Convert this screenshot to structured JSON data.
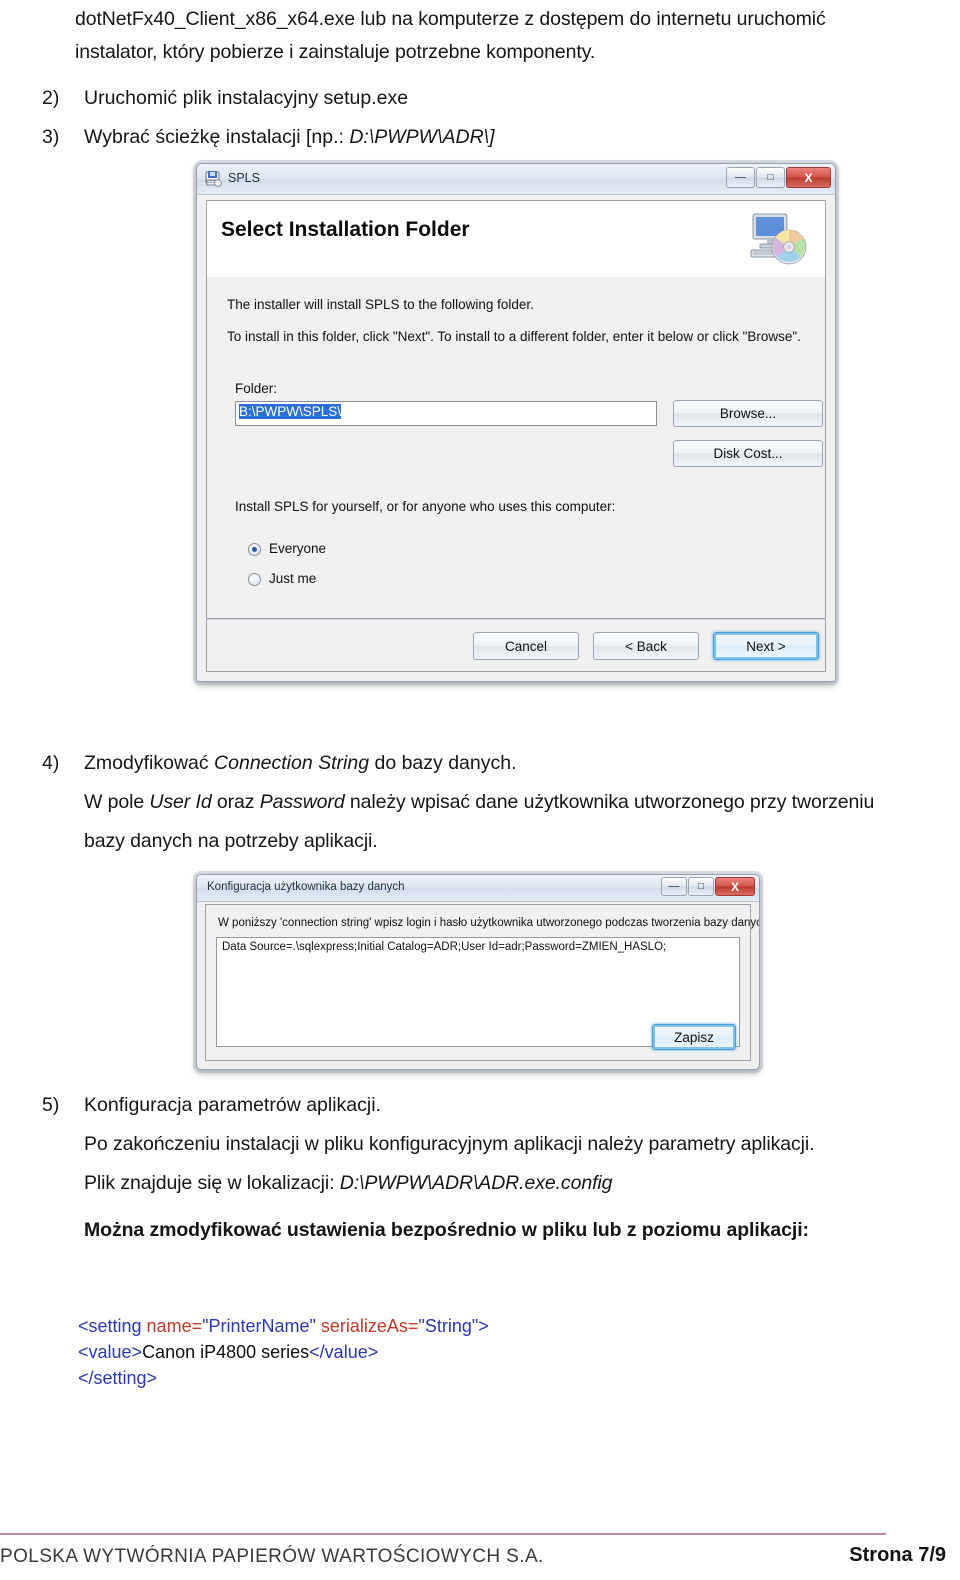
{
  "document": {
    "intro_line1": "dotNetFx40_Client_x86_x64.exe lub na komputerze z dostępem do internetu uruchomić",
    "intro_line2": "instalator, który pobierze i zainstaluje potrzebne komponenty."
  },
  "steps": {
    "s2": {
      "num": "2)",
      "text": "Uruchomić plik instalacyjny setup.exe"
    },
    "s3": {
      "num": "3)",
      "pre": "Wybrać ścieżkę instalacji [np.: ",
      "em": "D:\\PWPW\\ADR\\]",
      "post": ""
    },
    "s4": {
      "num": "4)",
      "l1_pre": "Zmodyfikować ",
      "l1_em": "Connection String",
      "l1_post": " do bazy danych.",
      "l2_pre": "W pole ",
      "l2_em1": "User Id",
      "l2_mid": " oraz ",
      "l2_em2": "Password",
      "l2_post": " należy wpisać dane użytkownika utworzonego przy tworzeniu",
      "l3": "bazy danych na potrzeby aplikacji."
    },
    "s5": {
      "num": "5)",
      "l1": "Konfiguracja parametrów aplikacji.",
      "l2": "Po zakończeniu instalacji w pliku konfiguracyjnym aplikacji należy parametry aplikacji.",
      "l3_pre": "Plik znajduje się w lokalizacji: ",
      "l3_em": "D:\\PWPW\\ADR\\ADR.exe.config",
      "l4": "Można zmodyfikować ustawienia bezpośrednio w pliku lub z poziomu aplikacji:"
    }
  },
  "installer_dialog": {
    "title": "SPLS",
    "icon": "installer-package-icon",
    "window_controls": {
      "minimize": "—",
      "maximize": "□",
      "close": "X"
    },
    "header": "Select Installation Folder",
    "header_icon": "computer-disc-icon",
    "line1": "The installer will install SPLS to the following folder.",
    "line2": "To install in this folder, click \"Next\". To install to a different folder, enter it below or click \"Browse\".",
    "folder_label": "Folder:",
    "folder_value": "B:\\PWPW\\SPLS\\",
    "browse_button": "Browse...",
    "diskcost_button": "Disk Cost...",
    "scope_label": "Install SPLS for yourself, or for anyone who uses this computer:",
    "radio_everyone": "Everyone",
    "radio_justme": "Just me",
    "radio_selected": "Everyone",
    "cancel_button": "Cancel",
    "back_button": "< Back",
    "next_button": "Next >",
    "focused_button": "Next >",
    "selection_color": "#2a6fd6"
  },
  "config_dialog": {
    "title": "Konfiguracja użytkownika bazy danych",
    "window_controls": {
      "minimize": "—",
      "maximize": "□",
      "close": "X"
    },
    "note": "W poniższy 'connection string' wpisz login i hasło użytkownika utworzonego podczas tworzenia bazy danych.",
    "connection_string": "Data Source=.\\sqlexpress;Initial Catalog=ADR;User Id=adr;Password=ZMIEN_HASLO;",
    "save_button": "Zapisz",
    "focused_button": "Zapisz"
  },
  "code_block": {
    "line1": {
      "open": "<setting ",
      "attr1": "name=",
      "val1": "\"PrinterName\" ",
      "attr2": "serializeAs=",
      "val2": "\"String\"",
      "close": ">"
    },
    "line2": {
      "open": "<value>",
      "content": "Canon iP4800 series",
      "close": "</value>"
    },
    "line3": {
      "close": "</setting>"
    },
    "colors": {
      "tag": "#2b37b5",
      "attribute": "#c0392b",
      "value": "#2b37b5",
      "text": "#111111"
    }
  },
  "footer": {
    "company": "POLSKA WYTWÓRNIA PAPIERÓW WARTOŚCIOWYCH S.A.",
    "page": "Strona 7/9",
    "rule_color": "#c08ba0"
  }
}
